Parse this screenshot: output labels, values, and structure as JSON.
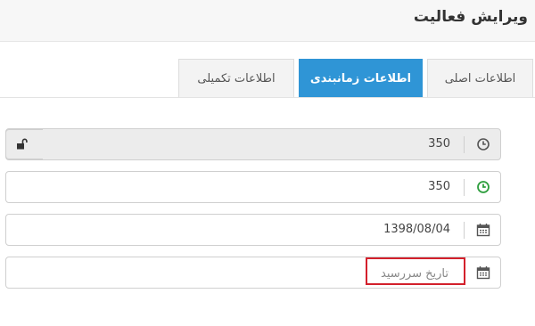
{
  "page": {
    "title": "ویرایش فعالیت"
  },
  "tabs": [
    {
      "label": "اطلاعات اصلی",
      "active": false
    },
    {
      "label": "اطلاعات زمانبندی",
      "active": true
    },
    {
      "label": "اطلاعات تکمیلی",
      "active": false
    }
  ],
  "fields": {
    "duration_locked": {
      "value": "350",
      "icon": "clock-icon",
      "disabled": true
    },
    "duration": {
      "value": "350",
      "icon": "clock-icon-green"
    },
    "start_date": {
      "value": "1398/08/04",
      "icon": "calendar-icon"
    },
    "due_date": {
      "value": "",
      "placeholder": "تاریخ سررسید",
      "icon": "calendar-icon"
    }
  },
  "colors": {
    "accent": "#2f95d6",
    "highlight": "#d3202c",
    "clock_green": "#2e9e3e"
  }
}
